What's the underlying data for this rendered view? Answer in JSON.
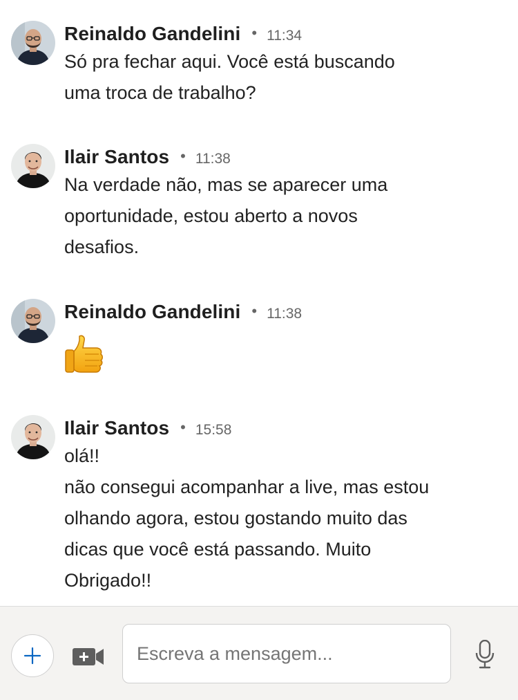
{
  "messages": [
    {
      "sender": "Reinaldo Gandelini",
      "time": "11:34",
      "lines": [
        "Só pra fechar aqui. Você está buscando",
        "uma troca de trabalho?"
      ]
    },
    {
      "sender": "Ilair Santos",
      "time": "11:38",
      "lines": [
        "Na verdade não, mas se aparecer uma",
        "oportunidade, estou aberto a novos",
        "desafios."
      ]
    },
    {
      "sender": "Reinaldo Gandelini",
      "time": "11:38",
      "reaction": "thumbs-up"
    },
    {
      "sender": "Ilair Santos",
      "time": "15:58",
      "lines": [
        "olá!!",
        "não consegui acompanhar a live, mas estou",
        "olhando agora, estou gostando muito das",
        "dicas que você está passando. Muito",
        "Obrigado!!"
      ]
    }
  ],
  "separator": "•",
  "composer": {
    "placeholder": "Escreva a mensagem...",
    "plus_icon": "plus-icon",
    "video_icon": "video-icon",
    "mic_icon": "microphone-icon"
  },
  "colors": {
    "accent": "#0a66c2",
    "composer_bg": "#f4f3f1",
    "icon_gray": "#5e5e5e"
  }
}
